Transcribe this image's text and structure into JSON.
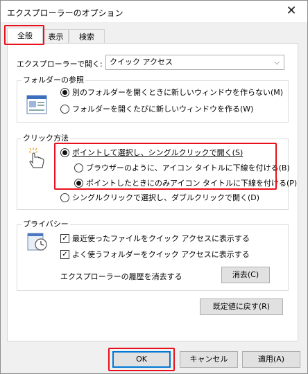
{
  "window": {
    "title": "エクスプローラーのオプション",
    "close_glyph": "✕"
  },
  "tabs": [
    {
      "label": "全般",
      "active": true
    },
    {
      "label": "表示",
      "active": false
    },
    {
      "label": "検索",
      "active": false
    }
  ],
  "open_in": {
    "label": "エクスプローラーで開く:",
    "value": "クイック アクセス"
  },
  "browse_folders": {
    "title": "フォルダーの参照",
    "options": [
      {
        "label": "別のフォルダーを開くときに新しいウィンドウを作らない(M)",
        "selected": true
      },
      {
        "label": "フォルダーを開くたびに新しいウィンドウを作る(W)",
        "selected": false
      }
    ]
  },
  "click_items": {
    "title": "クリック方法",
    "options": [
      {
        "label": "ポイントして選択し、シングルクリックで開く(S)",
        "selected": true
      },
      {
        "label": "ブラウザーのように、アイコン タイトルに下線を付ける(B)",
        "selected": false
      },
      {
        "label": "ポイントしたときにのみアイコン タイトルに下線を付ける(P)",
        "selected": true
      },
      {
        "label": "シングルクリックで選択し、ダブルクリックで開く(D)",
        "selected": false
      }
    ]
  },
  "privacy": {
    "title": "プライバシー",
    "options": [
      {
        "label": "最近使ったファイルをクイック アクセスに表示する",
        "checked": true
      },
      {
        "label": "よく使うフォルダーをクイック アクセスに表示する",
        "checked": true
      }
    ],
    "clear_label": "エクスプローラーの履歴を消去する",
    "clear_button": "消去(C)"
  },
  "restore_defaults": "既定値に戻す(R)",
  "footer": {
    "ok": "OK",
    "cancel": "キャンセル",
    "apply": "適用(A)"
  },
  "colors": {
    "highlight": "#e8101c",
    "accent": "#0078d7"
  }
}
